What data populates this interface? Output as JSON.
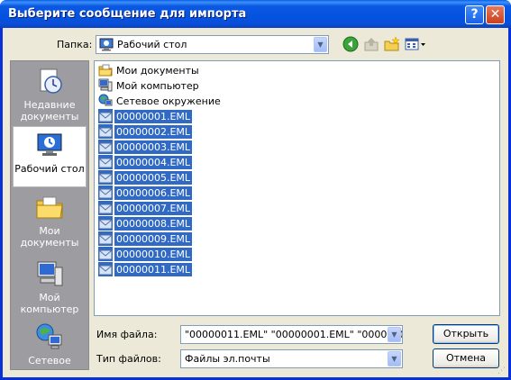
{
  "window": {
    "title": "Выберите сообщение для импорта",
    "help_glyph": "?",
    "close_glyph": "✕"
  },
  "lookin": {
    "label": "Папка:",
    "value": "Рабочий стол"
  },
  "toolbar": {
    "icons": [
      "back-icon",
      "up-folder-icon",
      "new-folder-icon",
      "views-menu-icon"
    ]
  },
  "places": [
    {
      "label": "Недавние документы",
      "icon": "recent-documents-icon",
      "selected": false
    },
    {
      "label": "Рабочий стол",
      "icon": "desktop-icon",
      "selected": true
    },
    {
      "label": "Мои документы",
      "icon": "my-documents-icon",
      "selected": false
    },
    {
      "label": "Мой компьютер",
      "icon": "my-computer-icon",
      "selected": false
    },
    {
      "label": "Сетевое",
      "icon": "network-icon",
      "selected": false
    }
  ],
  "files": [
    {
      "name": "Мои документы",
      "icon": "my-documents-icon",
      "selected": false
    },
    {
      "name": "Мой компьютер",
      "icon": "my-computer-icon",
      "selected": false
    },
    {
      "name": "Сетевое окружение",
      "icon": "network-icon",
      "selected": false
    },
    {
      "name": "00000001.EML",
      "icon": "eml-file-icon",
      "selected": true
    },
    {
      "name": "00000002.EML",
      "icon": "eml-file-icon",
      "selected": true
    },
    {
      "name": "00000003.EML",
      "icon": "eml-file-icon",
      "selected": true
    },
    {
      "name": "00000004.EML",
      "icon": "eml-file-icon",
      "selected": true
    },
    {
      "name": "00000005.EML",
      "icon": "eml-file-icon",
      "selected": true
    },
    {
      "name": "00000006.EML",
      "icon": "eml-file-icon",
      "selected": true
    },
    {
      "name": "00000007.EML",
      "icon": "eml-file-icon",
      "selected": true
    },
    {
      "name": "00000008.EML",
      "icon": "eml-file-icon",
      "selected": true
    },
    {
      "name": "00000009.EML",
      "icon": "eml-file-icon",
      "selected": true
    },
    {
      "name": "00000010.EML",
      "icon": "eml-file-icon",
      "selected": true
    },
    {
      "name": "00000011.EML",
      "icon": "eml-file-icon",
      "selected": true
    }
  ],
  "filename": {
    "label": "Имя файла:",
    "value": "\"00000011.EML\" \"00000001.EML\" \"0000000"
  },
  "filetype": {
    "label": "Тип файлов:",
    "value": "Файлы эл.почты"
  },
  "buttons": {
    "open": "Открыть",
    "cancel": "Отмена"
  },
  "colors": {
    "title_bar": "#0a5ee8",
    "selection": "#316ac5",
    "dialog_bg": "#ece9d8",
    "places_bg": "#9d9da1"
  }
}
